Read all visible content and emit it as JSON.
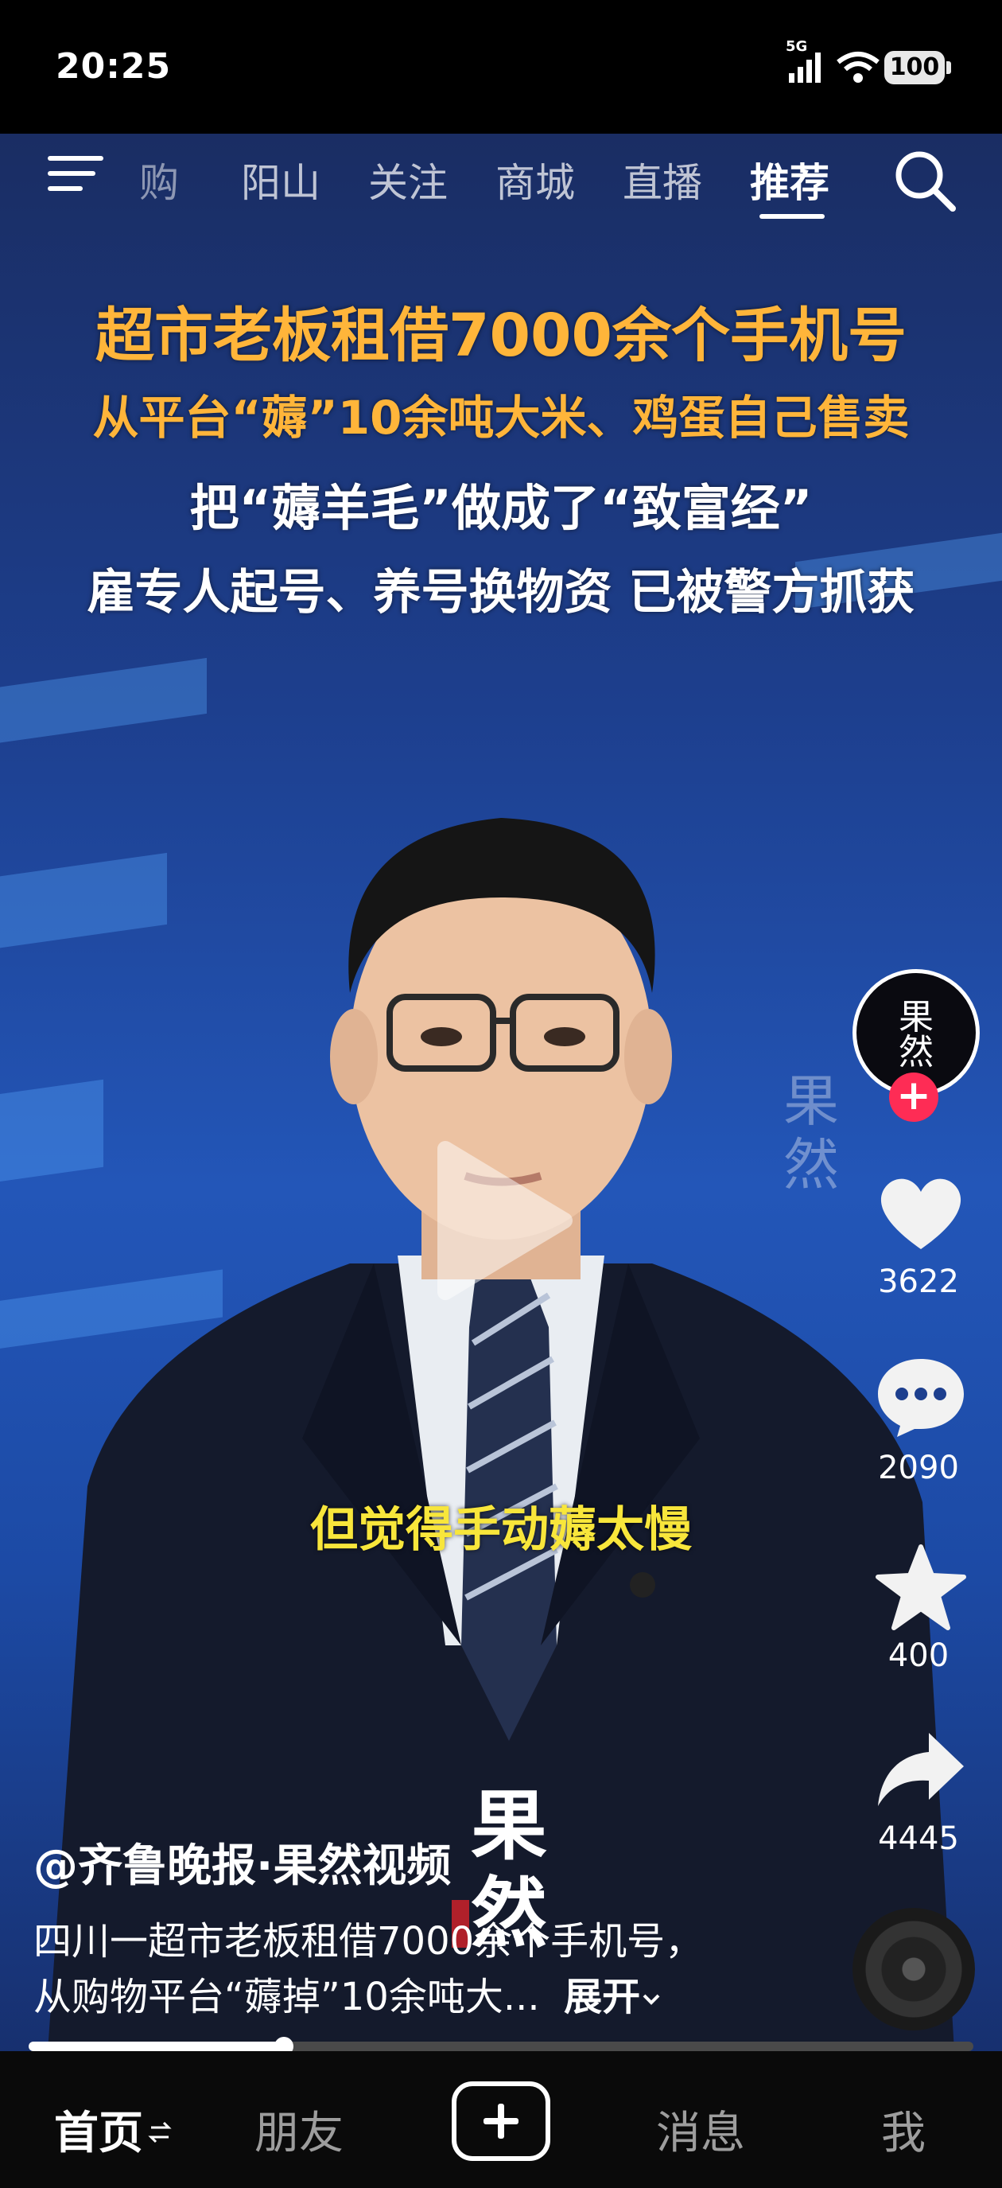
{
  "status_bar": {
    "time": "20:25",
    "network": "5G",
    "battery": "100"
  },
  "top_nav": {
    "tabs": [
      "购",
      "阳山",
      "关注",
      "商城",
      "直播",
      "推荐"
    ],
    "active_tab": "推荐"
  },
  "video": {
    "headline_1": "超市老板租借7000余个手机号",
    "headline_2": "从平台“薅”10余吨大米、鸡蛋自己售卖",
    "headline_3": "把“薅羊毛”做成了“致富经”",
    "headline_4": "雇专人起号、养号换物资 已被警方抓获",
    "subtitle": "但觉得手动薅太慢"
  },
  "actions": {
    "likes": "3622",
    "comments": "2090",
    "favorites": "400",
    "shares": "4445"
  },
  "post": {
    "author": "@齐鲁晚报·果然视频",
    "description_line1": "四川一超市老板租借7000余个手机号，",
    "description_line2": "从购物平台“薅掉”10余吨大...",
    "expand_label": "展开"
  },
  "progress": {
    "played_fraction": 0.27
  },
  "bottom_nav": {
    "home": "首页",
    "friends": "朋友",
    "messages": "消息",
    "me": "我"
  },
  "colors": {
    "headline_orange": "#ffb53a",
    "subtitle_yellow": "#f8e63b",
    "follow_red": "#fe2c55"
  },
  "icons": [
    "menu-icon",
    "search-icon",
    "play-icon",
    "heart-icon",
    "comment-icon",
    "star-icon",
    "share-icon",
    "plus-icon",
    "swap-icon",
    "music-disc-icon"
  ]
}
